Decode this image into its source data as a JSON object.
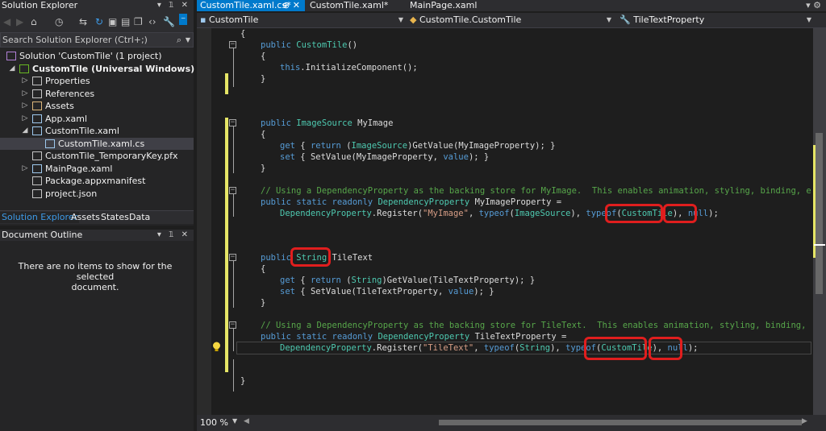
{
  "solution_explorer": {
    "title": "Solution Explorer",
    "search_placeholder": "Search Solution Explorer (Ctrl+;)",
    "tree": [
      {
        "label": "Solution 'CustomTile' (1 project)",
        "indent": 0,
        "expander": "",
        "icon": "solution-icon",
        "bold": false
      },
      {
        "label": "CustomTile (Universal Windows)",
        "indent": 1,
        "expander": "◢",
        "icon": "csharp-project-icon",
        "bold": true
      },
      {
        "label": "Properties",
        "indent": 2,
        "expander": "▷",
        "icon": "wrench-icon",
        "bold": false
      },
      {
        "label": "References",
        "indent": 2,
        "expander": "▷",
        "icon": "references-icon",
        "bold": false
      },
      {
        "label": "Assets",
        "indent": 2,
        "expander": "▷",
        "icon": "folder-icon",
        "bold": false
      },
      {
        "label": "App.xaml",
        "indent": 2,
        "expander": "▷",
        "icon": "xaml-file-icon",
        "bold": false
      },
      {
        "label": "CustomTile.xaml",
        "indent": 2,
        "expander": "◢",
        "icon": "xaml-file-icon",
        "bold": false
      },
      {
        "label": "CustomTile.xaml.cs",
        "indent": 3,
        "expander": "",
        "icon": "cs-file-icon",
        "bold": false
      },
      {
        "label": "CustomTile_TemporaryKey.pfx",
        "indent": 2,
        "expander": "",
        "icon": "key-file-icon",
        "bold": false
      },
      {
        "label": "MainPage.xaml",
        "indent": 2,
        "expander": "▷",
        "icon": "xaml-file-icon",
        "bold": false
      },
      {
        "label": "Package.appxmanifest",
        "indent": 2,
        "expander": "",
        "icon": "manifest-icon",
        "bold": false
      },
      {
        "label": "project.json",
        "indent": 2,
        "expander": "",
        "icon": "json-file-icon",
        "bold": false
      }
    ],
    "tabs": [
      "Solution Explorer",
      "Assets",
      "States",
      "Data"
    ]
  },
  "document_outline": {
    "title": "Document Outline",
    "message_line1": "There are no items to show for the selected",
    "message_line2": "document."
  },
  "editor": {
    "tabs": [
      {
        "label": "CustomTile.xaml.cs*",
        "extra": "⊕ ✕",
        "active": true
      },
      {
        "label": "CustomTile.xaml*",
        "extra": "",
        "active": false
      },
      {
        "label": "MainPage.xaml",
        "extra": "",
        "active": false
      }
    ],
    "nav": {
      "project": "CustomTile",
      "class": "CustomTile.CustomTile",
      "member": "TileTextProperty"
    },
    "zoom": "100 %",
    "code_lines": [
      "{",
      "public CustomTile()",
      "{",
      "this.InitializeComponent();",
      "}",
      "public ImageSource MyImage",
      "{",
      "get { return (ImageSource)GetValue(MyImageProperty); }",
      "set { SetValue(MyImageProperty, value); }",
      "}",
      "// Using a DependencyProperty as the backing store for MyImage.  This enables animation, styling, binding, etc...",
      "public static readonly DependencyProperty MyImageProperty =",
      "DependencyProperty.Register(\"MyImage\", typeof(ImageSource), typeof(CustomTile), null);",
      "public String TileText",
      "{",
      "get { return (String)GetValue(TileTextProperty); }",
      "set { SetValue(TileTextProperty, value); }",
      "}",
      "// Using a DependencyProperty as the backing store for TileText.  This enables animation, styling, binding, etc...",
      "public static readonly DependencyProperty TileTextProperty =",
      "DependencyProperty.Register(\"TileText\", typeof(String), typeof(CustomTile), null);",
      "}"
    ]
  },
  "colors": {
    "accent": "#007acc",
    "annotation_red": "#e01e1e",
    "keyword": "#569cd6",
    "type": "#4ec9b0",
    "comment": "#57a64a",
    "string": "#d69d85"
  }
}
